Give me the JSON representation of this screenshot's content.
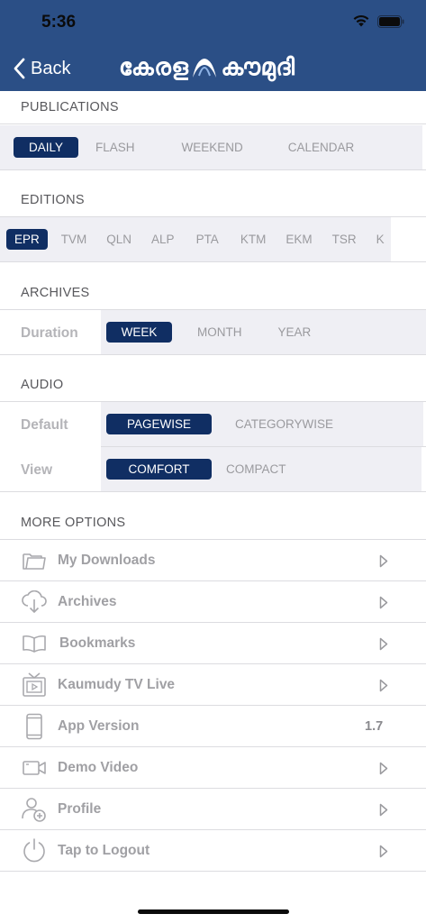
{
  "status_bar": {
    "time": "5:36"
  },
  "navbar": {
    "back_label": "Back",
    "logo_left": "കേരള",
    "logo_right": "കൗമുദി",
    "background": "#2b4f86"
  },
  "publications": {
    "header": "PUBLICATIONS",
    "items": [
      "DAILY",
      "FLASH",
      "WEEKEND",
      "CALENDAR"
    ],
    "selected": "DAILY"
  },
  "editions": {
    "header": "EDITIONS",
    "items": [
      "EPR",
      "TVM",
      "QLN",
      "ALP",
      "PTA",
      "KTM",
      "EKM",
      "TSR",
      "K"
    ],
    "selected": "EPR"
  },
  "archives": {
    "header": "ARCHIVES",
    "duration_label": "Duration",
    "items": [
      "WEEK",
      "MONTH",
      "YEAR"
    ],
    "selected": "WEEK"
  },
  "audio": {
    "header": "AUDIO",
    "default_label": "Default",
    "default_items": [
      "PAGEWISE",
      "CATEGORYWISE"
    ],
    "default_selected": "PAGEWISE",
    "view_label": "View",
    "view_items": [
      "COMFORT",
      "COMPACT"
    ],
    "view_selected": "COMFORT"
  },
  "more_options": {
    "header": "MORE OPTIONS",
    "items": [
      {
        "label": "My Downloads",
        "icon": "folder-icon"
      },
      {
        "label": "Archives",
        "icon": "cloud-download-icon"
      },
      {
        "label": "Bookmarks",
        "icon": "book-icon"
      },
      {
        "label": "Kaumudy TV Live",
        "icon": "tv-icon"
      },
      {
        "label": "App Version",
        "icon": "phone-icon",
        "value": "1.7"
      },
      {
        "label": "Demo Video",
        "icon": "video-camera-icon"
      },
      {
        "label": "Profile",
        "icon": "add-user-icon"
      },
      {
        "label": "Tap to Logout",
        "icon": "power-icon"
      }
    ]
  },
  "colors": {
    "accent": "#102e63",
    "strip": "#efeff4"
  }
}
